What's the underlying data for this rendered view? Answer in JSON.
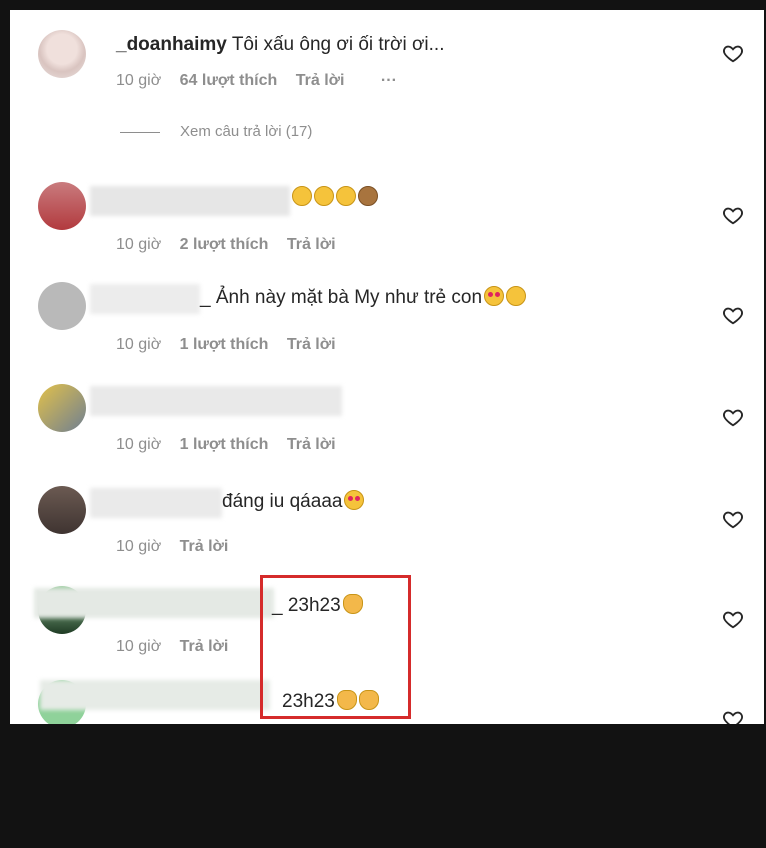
{
  "colors": {
    "text": "#262626",
    "meta": "#8e8e8e",
    "highlight": "#d52b2b",
    "frame": "#121212"
  },
  "comments": [
    {
      "username": "_doanhaimy",
      "text": "Tôi xấu ông ơi ối trời ơi...",
      "time": "10 giờ",
      "likes": "64 lượt thích",
      "reply": "Trả lời",
      "more": "···"
    },
    {
      "text": "",
      "emoji": [
        "grin",
        "grin",
        "grin",
        "monkey"
      ],
      "time": "10 giờ",
      "likes": "2 lượt thích",
      "reply": "Trả lời"
    },
    {
      "text": "_ Ảnh này mặt bà My như trẻ con",
      "emoji": [
        "heart-eyes",
        "grin"
      ],
      "time": "10 giờ",
      "likes": "1 lượt thích",
      "reply": "Trả lời"
    },
    {
      "text": "",
      "time": "10 giờ",
      "likes": "1 lượt thích",
      "reply": "Trả lời"
    },
    {
      "text": "đáng iu qáaaa",
      "emoji": [
        "heart-eyes"
      ],
      "time": "10 giờ",
      "reply": "Trả lời"
    },
    {
      "text": "_ 23h23",
      "emoji": [
        "clap"
      ],
      "time": "10 giờ",
      "reply": "Trả lời"
    },
    {
      "text": "23h23",
      "emoji": [
        "clap",
        "clap"
      ]
    }
  ],
  "view_replies": "Xem câu trả lời (17)",
  "icons": {
    "like": "heart-outline-icon",
    "more": "ellipsis-icon"
  }
}
